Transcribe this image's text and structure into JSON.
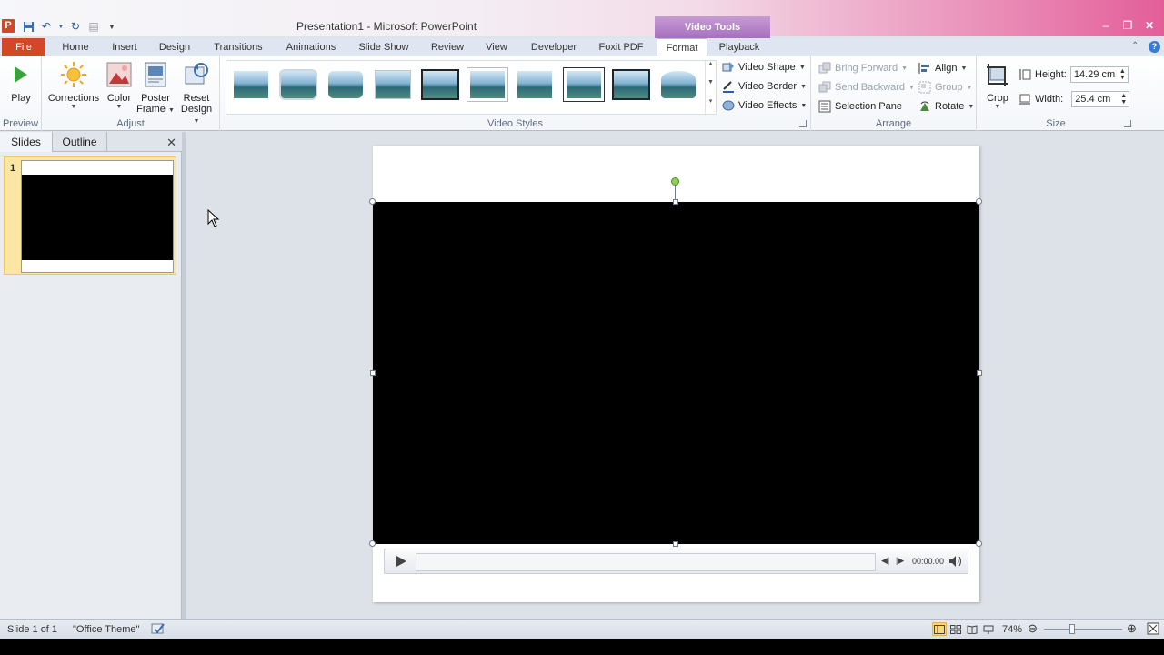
{
  "window": {
    "title": "Presentation1 - Microsoft PowerPoint",
    "app_icon_letter": "P",
    "contextual_group": "Video Tools"
  },
  "tabs": [
    "File",
    "Home",
    "Insert",
    "Design",
    "Transitions",
    "Animations",
    "Slide Show",
    "Review",
    "View",
    "Developer",
    "Foxit PDF",
    "Format",
    "Playback"
  ],
  "active_tab": "Format",
  "ribbon": {
    "preview": {
      "label": "Preview",
      "play": "Play"
    },
    "adjust": {
      "label": "Adjust",
      "corrections": "Corrections",
      "color": "Color",
      "poster_frame_line1": "Poster",
      "poster_frame_line2": "Frame",
      "reset_design_line1": "Reset",
      "reset_design_line2": "Design"
    },
    "video_styles": {
      "label": "Video Styles",
      "video_shape": "Video Shape",
      "video_border": "Video Border",
      "video_effects": "Video Effects"
    },
    "arrange": {
      "label": "Arrange",
      "bring_forward": "Bring Forward",
      "send_backward": "Send Backward",
      "selection_pane": "Selection Pane",
      "align": "Align",
      "group": "Group",
      "rotate": "Rotate"
    },
    "size": {
      "label": "Size",
      "crop": "Crop",
      "height_label": "Height:",
      "height_value": "14.29 cm",
      "width_label": "Width:",
      "width_value": "25.4 cm"
    }
  },
  "left_pane": {
    "tab_slides": "Slides",
    "tab_outline": "Outline",
    "slide_number": "1"
  },
  "video": {
    "time": "00:00.00"
  },
  "status": {
    "slide_info": "Slide 1 of 1",
    "theme": "\"Office Theme\"",
    "zoom": "74%"
  },
  "colors": {
    "file_tab": "#d24726",
    "contextual": "#b07fc8",
    "rotate_handle": "#8fd14f"
  }
}
